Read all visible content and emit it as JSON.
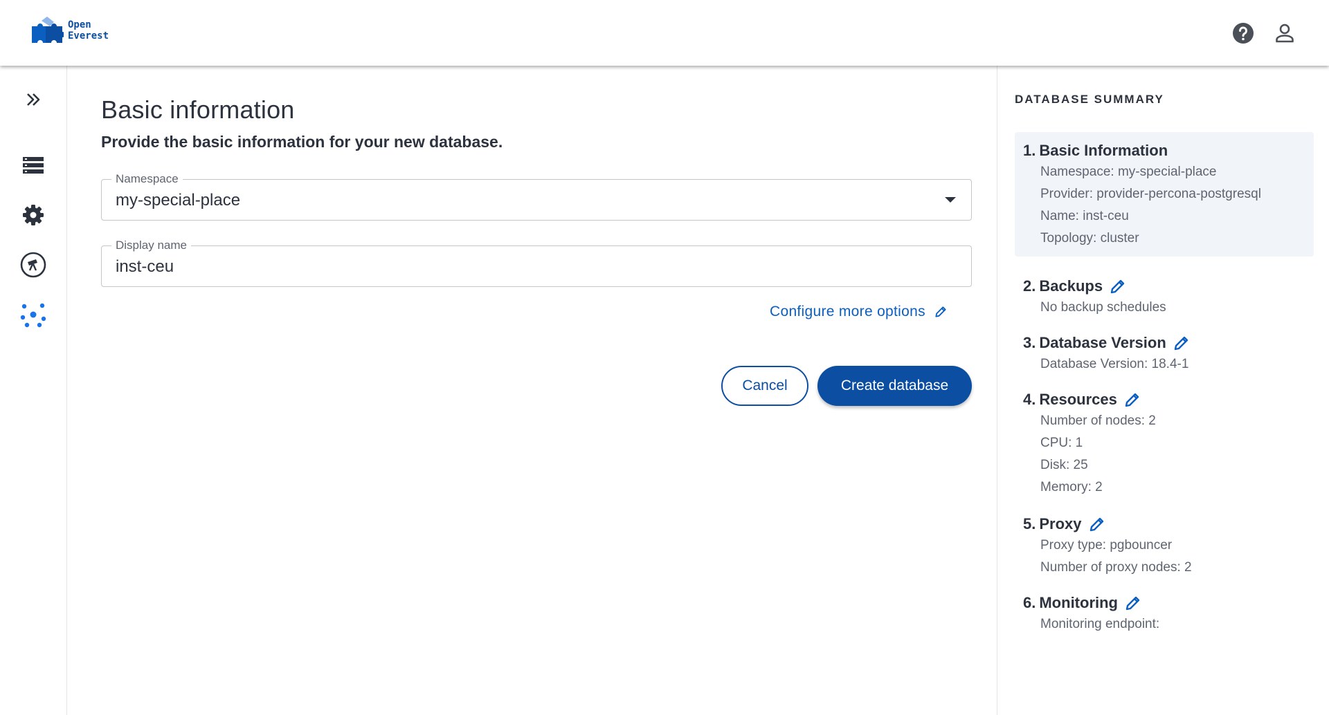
{
  "app": {
    "logo_line1": "Open",
    "logo_line2": "Everest",
    "help_icon": "help-circle-icon",
    "account_icon": "user-icon"
  },
  "sidebar": {
    "items": [
      {
        "name": "expand-sidebar",
        "icon": "chevrons-right-icon"
      },
      {
        "name": "databases",
        "icon": "database-list-icon"
      },
      {
        "name": "settings",
        "icon": "gear-icon"
      },
      {
        "name": "observability",
        "icon": "telescope-icon"
      },
      {
        "name": "topology",
        "icon": "cluster-nodes-icon"
      }
    ]
  },
  "form": {
    "title": "Basic information",
    "subtitle": "Provide the basic information for your new database.",
    "namespace": {
      "label": "Namespace",
      "value": "my-special-place"
    },
    "display_name": {
      "label": "Display name",
      "value": "inst-ceu"
    },
    "configure_more": "Configure more options",
    "cancel_label": "Cancel",
    "create_label": "Create database"
  },
  "summary": {
    "title": "DATABASE SUMMARY",
    "sections": [
      {
        "num": "1.",
        "name": "Basic Information",
        "rows": [
          "Namespace: my-special-place",
          "Provider: provider-percona-postgresql",
          "Name: inst-ceu",
          "Topology: cluster"
        ]
      },
      {
        "num": "2.",
        "name": "Backups",
        "rows": [
          "No backup schedules"
        ]
      },
      {
        "num": "3.",
        "name": "Database Version",
        "rows": [
          "Database Version: 18.4-1"
        ]
      },
      {
        "num": "4.",
        "name": "Resources",
        "rows": [
          "Number of nodes: 2",
          "CPU: 1",
          "Disk: 25",
          "Memory: 2"
        ]
      },
      {
        "num": "5.",
        "name": "Proxy",
        "rows": [
          "Proxy type: pgbouncer",
          "Number of proxy nodes: 2"
        ]
      },
      {
        "num": "6.",
        "name": "Monitoring",
        "rows": [
          "Monitoring endpoint:"
        ]
      }
    ]
  },
  "colors": {
    "primary": "#0b4ea2",
    "link": "#0b5fc1",
    "text": "#2c323e",
    "muted": "#5f6570",
    "active_section_bg": "#f1f4f9"
  }
}
